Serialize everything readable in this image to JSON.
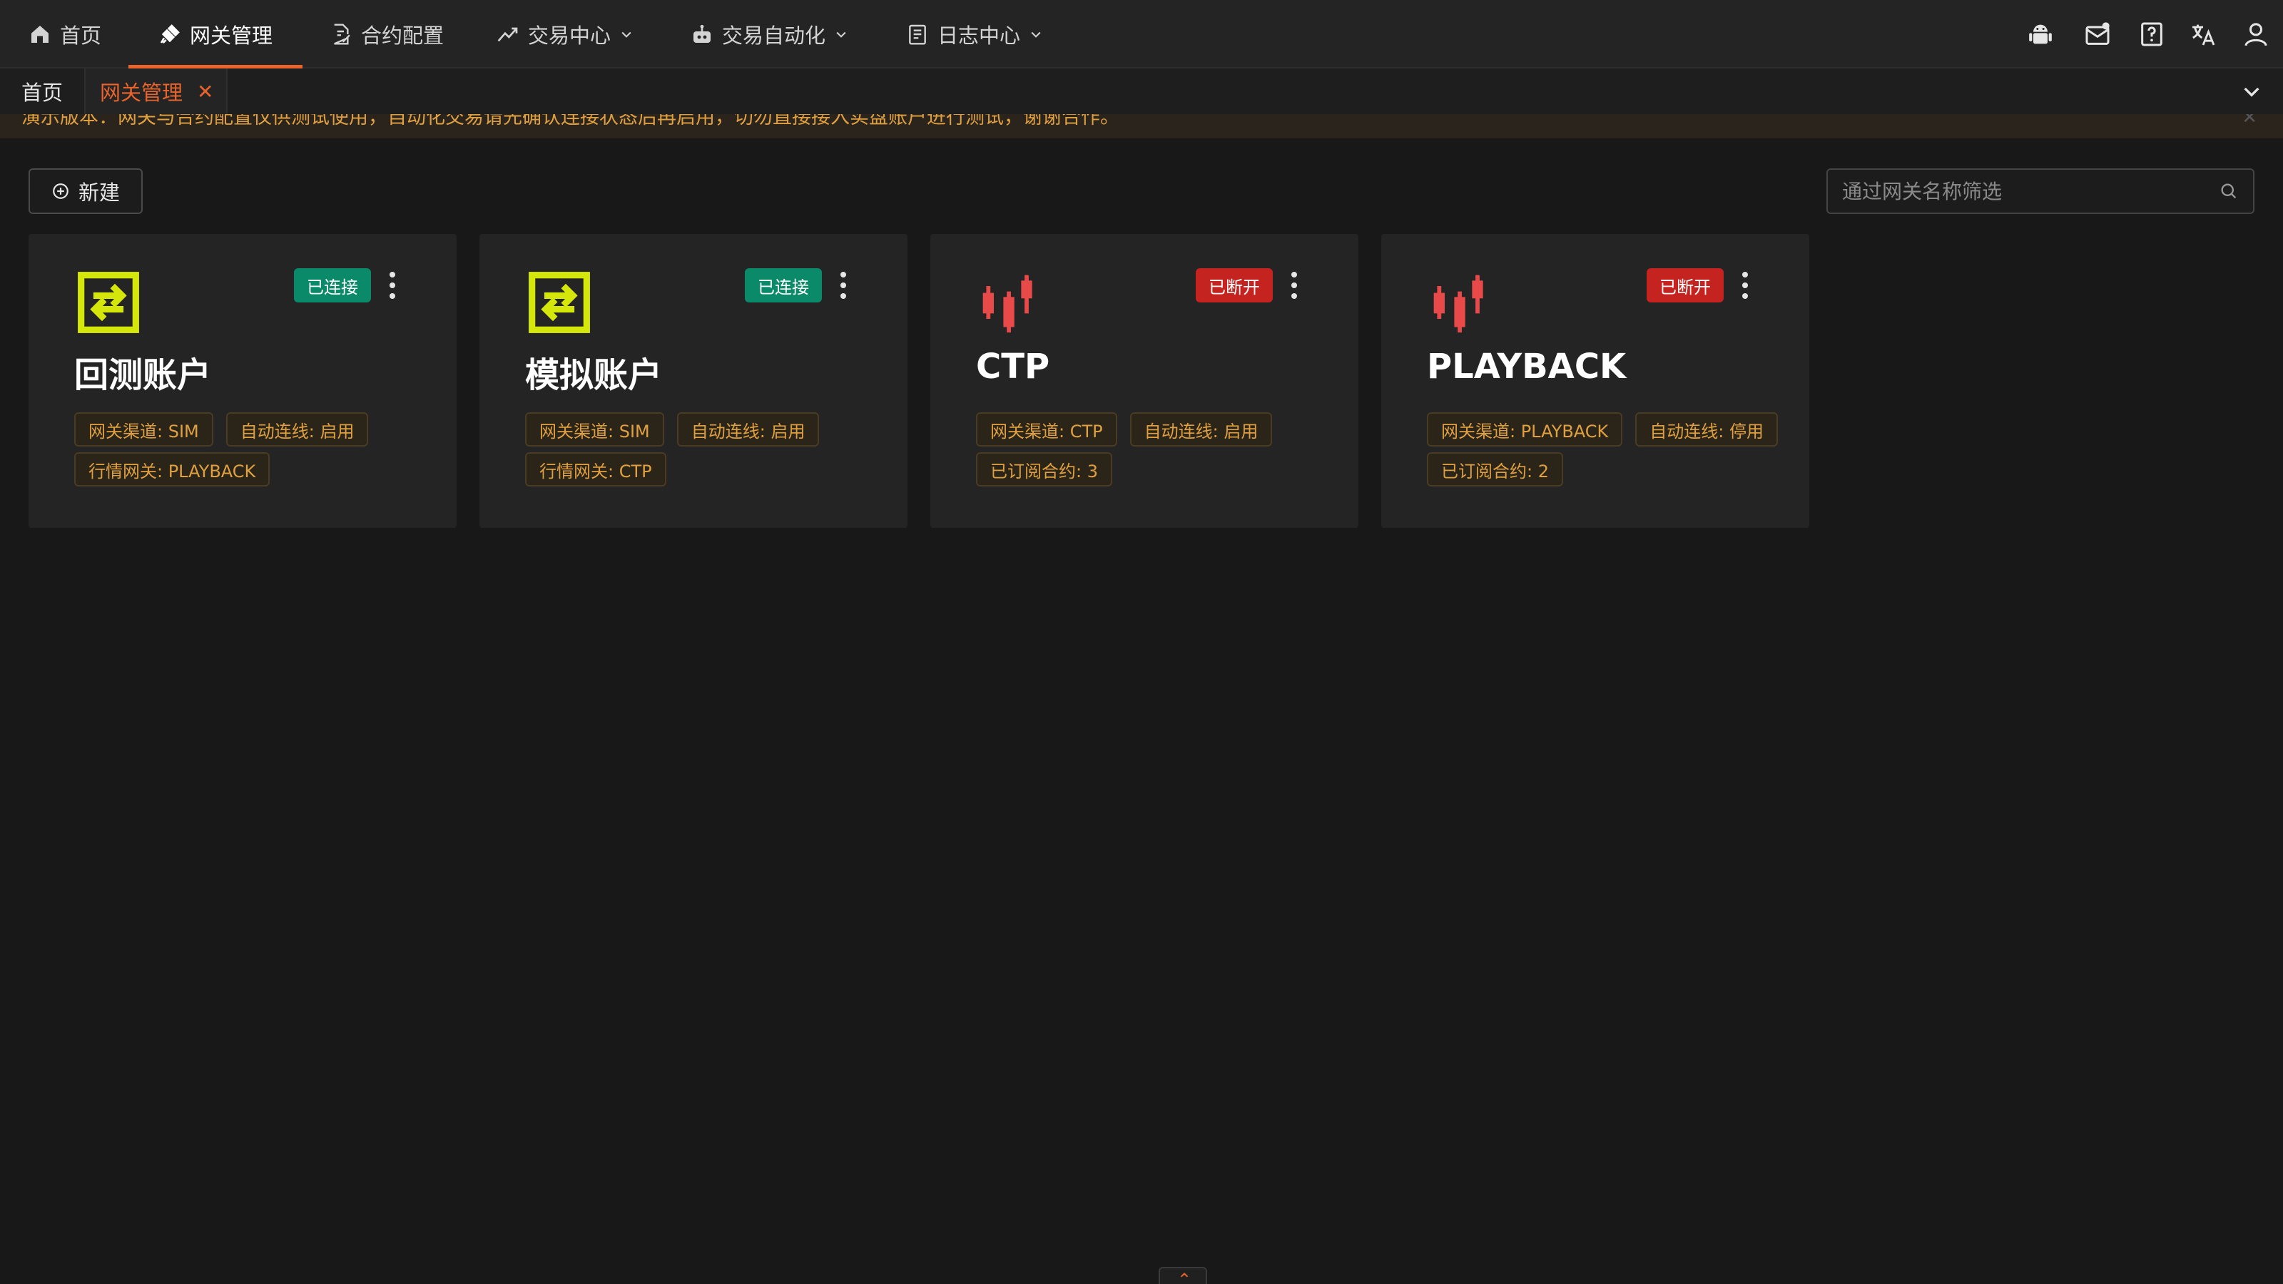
{
  "nav": {
    "items": [
      {
        "label": "首页",
        "icon": "home-icon"
      },
      {
        "label": "网关管理",
        "icon": "plug-icon",
        "active": true
      },
      {
        "label": "合约配置",
        "icon": "document-edit-icon"
      },
      {
        "label": "交易中心",
        "icon": "trend-up-icon",
        "dropdown": true
      },
      {
        "label": "交易自动化",
        "icon": "robot-icon",
        "dropdown": true
      },
      {
        "label": "日志中心",
        "icon": "log-icon",
        "dropdown": true
      }
    ],
    "right_icons": [
      "android-icon",
      "mail-icon",
      "help-icon",
      "translate-icon",
      "user-icon"
    ],
    "accent_color": "#e8642c"
  },
  "tabs": {
    "home_label": "首页",
    "active_label": "网关管理",
    "close_symbol": "✕"
  },
  "notice": {
    "text": "演示版本：网关与合约配置仅供测试使用，自动化交易请先确认连接状态后再启用，切勿直接接入实盘账户进行测试，谢谢合作。"
  },
  "toolbar": {
    "new_label": "新建",
    "search_placeholder": "通过网关名称筛选"
  },
  "cards": [
    {
      "title": "回测账户",
      "icon": "exchange-icon",
      "status": "已连接",
      "status_color": "#0b8a6a",
      "tags": [
        "网关渠道: SIM",
        "自动连线: 启用",
        "行情网关: PLAYBACK"
      ]
    },
    {
      "title": "模拟账户",
      "icon": "exchange-icon",
      "status": "已连接",
      "status_color": "#0b8a6a",
      "tags": [
        "网关渠道: SIM",
        "自动连线: 启用",
        "行情网关: CTP"
      ]
    },
    {
      "title": "CTP",
      "icon": "candlestick-icon",
      "status": "已断开",
      "status_color": "#c4231f",
      "tags": [
        "网关渠道: CTP",
        "自动连线: 启用",
        "已订阅合约: 3"
      ]
    },
    {
      "title": "PLAYBACK",
      "icon": "candlestick-icon",
      "status": "已断开",
      "status_color": "#c4231f",
      "tags": [
        "网关渠道: PLAYBACK",
        "自动连线: 停用",
        "已订阅合约: 2"
      ]
    }
  ]
}
